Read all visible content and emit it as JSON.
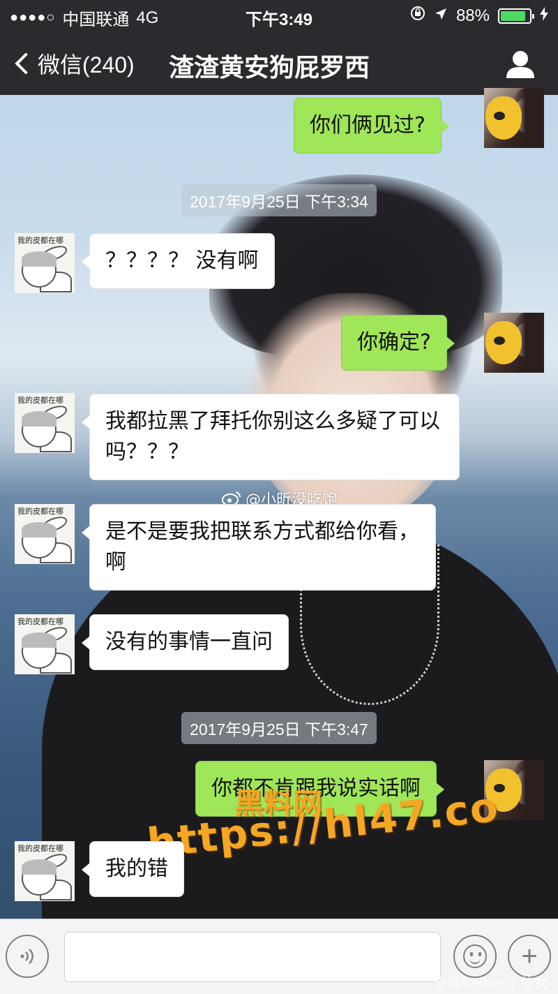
{
  "status_bar": {
    "signal": "●●●●○",
    "carrier": "中国联通",
    "network": "4G",
    "time": "下午3:49",
    "battery_text": "88%",
    "battery_level": 0.88
  },
  "nav": {
    "back_label": "微信(240)",
    "title": "渣渣黄安狗屁罗西"
  },
  "avatars": {
    "contact_tag": "我的皮都在哪"
  },
  "messages": [
    {
      "side": "right",
      "text": "你们俩见过?"
    },
    {
      "type": "time",
      "text": "2017年9月25日 下午3:34"
    },
    {
      "side": "left",
      "text": "？？？？ 没有啊"
    },
    {
      "side": "right",
      "text": "你确定?"
    },
    {
      "side": "left",
      "text": "我都拉黑了拜托你别这么多疑了可以吗？？？"
    },
    {
      "side": "left",
      "text": "是不是要我把联系方式都给你看，啊"
    },
    {
      "side": "left",
      "text": "没有的事情一直问"
    },
    {
      "type": "time",
      "text": "2017年9月25日 下午3:47"
    },
    {
      "side": "right",
      "text": "你都不肯跟我说实话啊"
    },
    {
      "side": "left",
      "text": "我的错"
    }
  ],
  "watermarks": {
    "weibo_handle": "@小昕没吃饱",
    "site_name": "黑料网",
    "site_url": "https://hl47.co",
    "bottom_handle": "@陈beiber小仙女"
  },
  "input_bar": {
    "voice_icon": "voice-icon",
    "emoji_icon": "emoji-icon",
    "plus_icon": "plus-icon",
    "plus_glyph": "+"
  }
}
